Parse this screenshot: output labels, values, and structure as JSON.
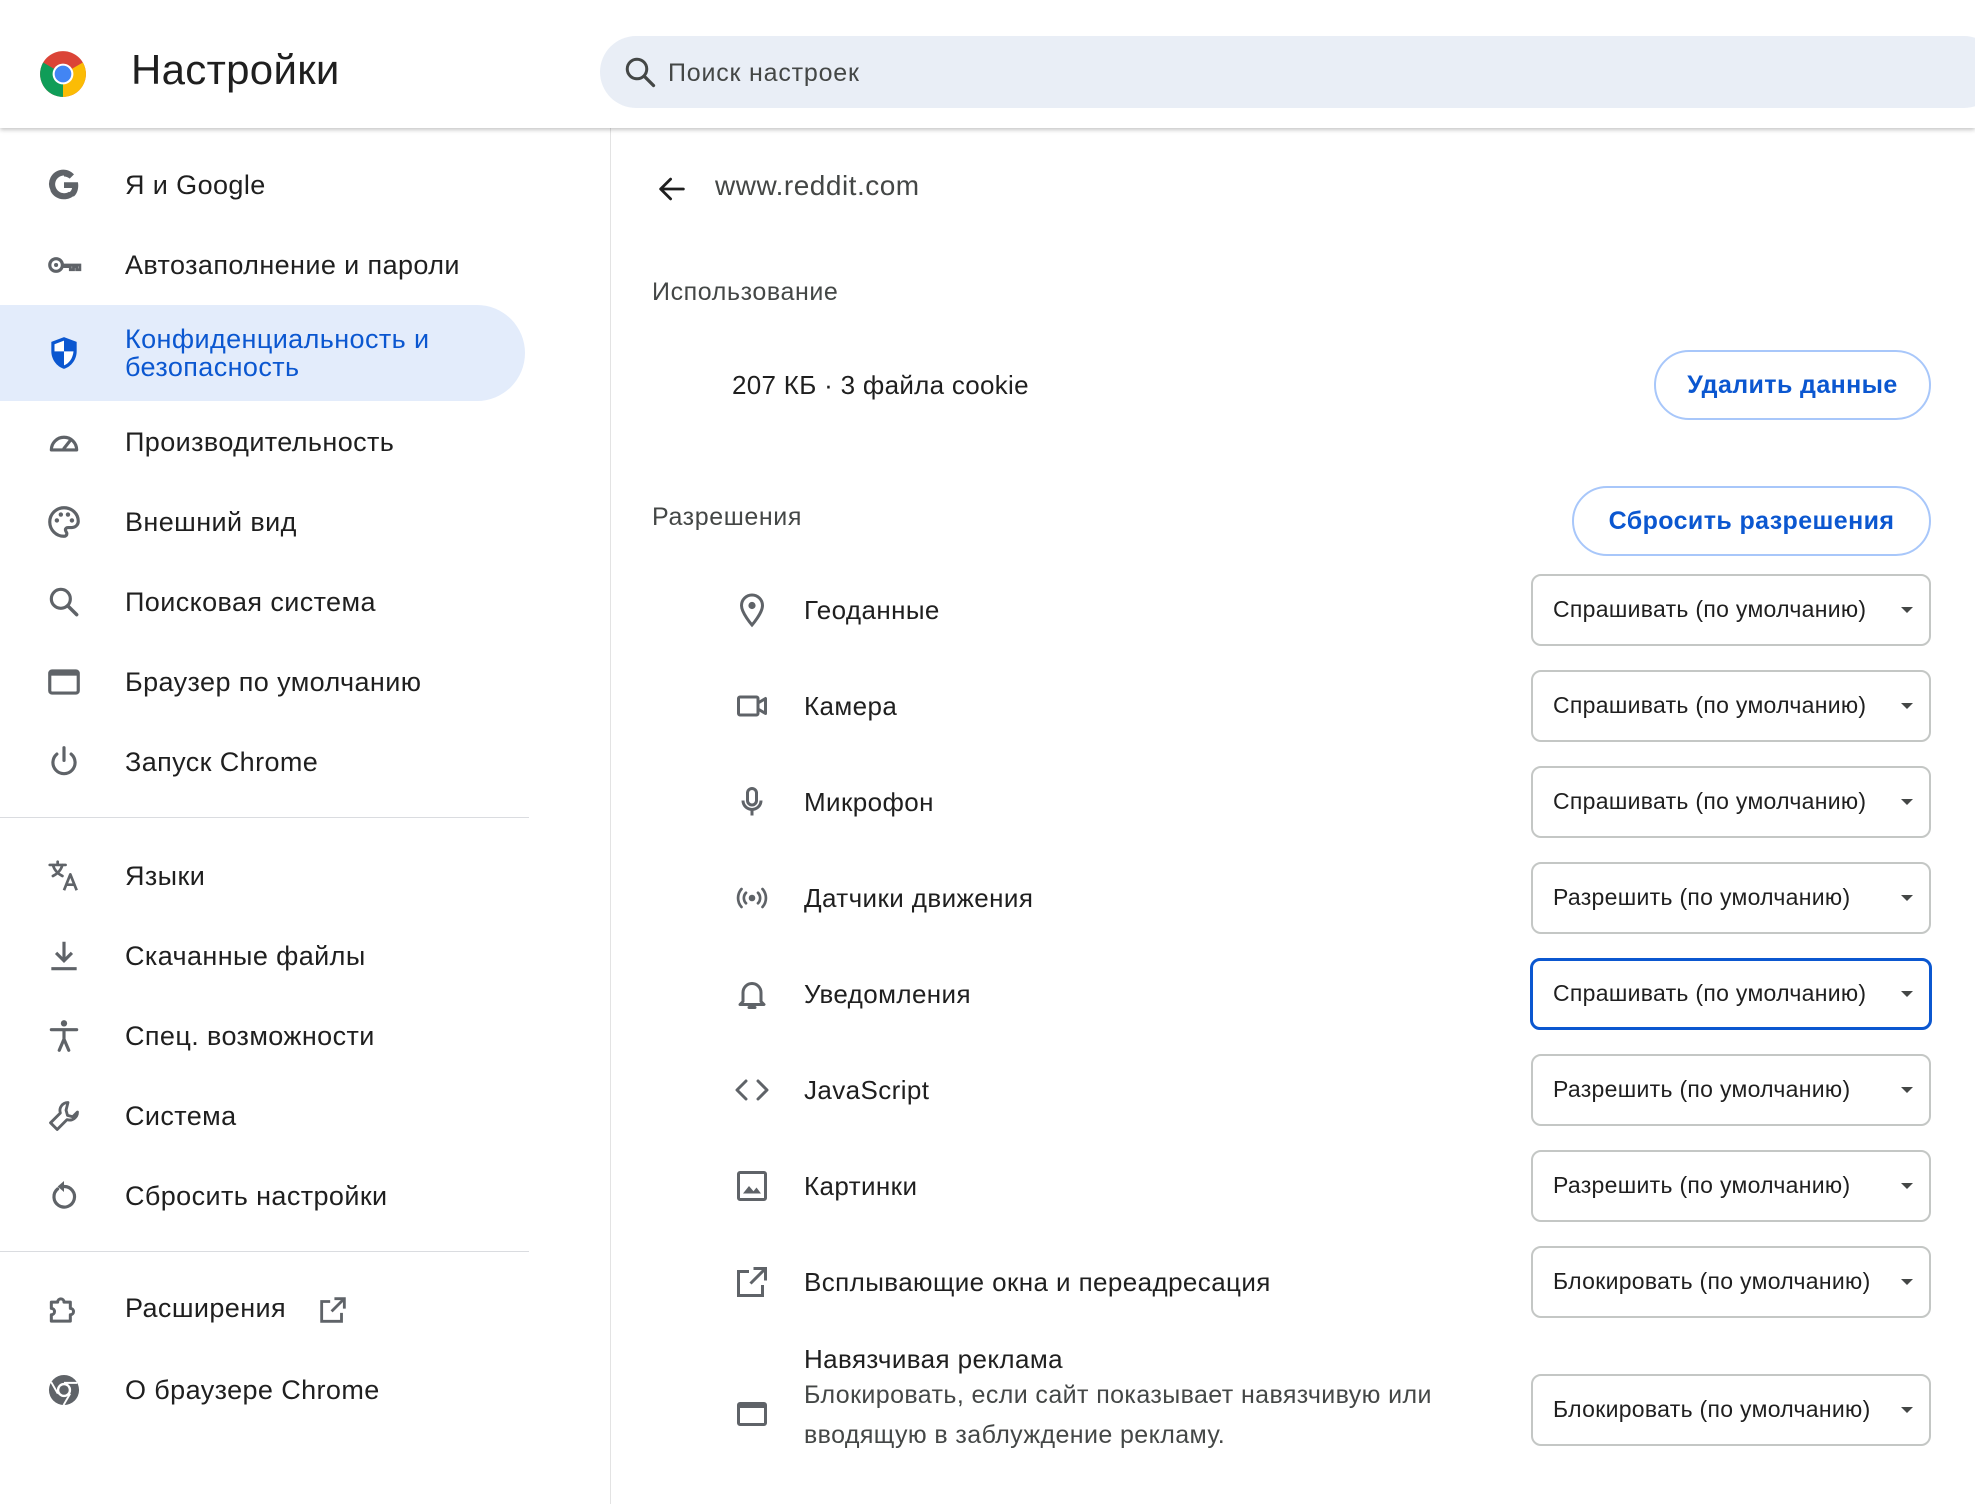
{
  "header": {
    "app_title": "Настройки",
    "search_placeholder": "Поиск настроек"
  },
  "sidebar": {
    "items": [
      {
        "label": "Я и Google",
        "icon": "google-g-icon"
      },
      {
        "label": "Автозаполнение и пароли",
        "icon": "key-icon"
      },
      {
        "label": "Конфиденциальность и безопасность",
        "icon": "shield-icon",
        "active": true
      },
      {
        "label": "Производительность",
        "icon": "speedometer-icon"
      },
      {
        "label": "Внешний вид",
        "icon": "palette-icon"
      },
      {
        "label": "Поисковая система",
        "icon": "search-icon"
      },
      {
        "label": "Браузер по умолчанию",
        "icon": "browser-window-icon"
      },
      {
        "label": "Запуск Chrome",
        "icon": "power-icon"
      },
      {
        "label": "Языки",
        "icon": "translate-icon"
      },
      {
        "label": "Скачанные файлы",
        "icon": "download-icon"
      },
      {
        "label": "Спец. возможности",
        "icon": "accessibility-icon"
      },
      {
        "label": "Система",
        "icon": "wrench-icon"
      },
      {
        "label": "Сбросить настройки",
        "icon": "reset-icon"
      },
      {
        "label": "Расширения",
        "icon": "puzzle-icon"
      },
      {
        "label": "О браузере Chrome",
        "icon": "chrome-icon"
      }
    ]
  },
  "main": {
    "site": "www.reddit.com",
    "usage": {
      "title": "Использование",
      "summary": "207 КБ · 3 файла cookie",
      "delete_button": "Удалить данные"
    },
    "permissions": {
      "title": "Разрешения",
      "reset_button": "Сбросить разрешения",
      "items": [
        {
          "label": "Геоданные",
          "value": "Спрашивать (по умолчанию)",
          "icon": "location-pin-icon"
        },
        {
          "label": "Камера",
          "value": "Спрашивать (по умолчанию)",
          "icon": "camera-icon"
        },
        {
          "label": "Микрофон",
          "value": "Спрашивать (по умолчанию)",
          "icon": "microphone-icon"
        },
        {
          "label": "Датчики движения",
          "value": "Разрешить (по умолчанию)",
          "icon": "sensors-icon"
        },
        {
          "label": "Уведомления",
          "value": "Спрашивать (по умолчанию)",
          "icon": "bell-icon",
          "focused": true
        },
        {
          "label": "JavaScript",
          "value": "Разрешить (по умолчанию)",
          "icon": "code-icon"
        },
        {
          "label": "Картинки",
          "value": "Разрешить (по умолчанию)",
          "icon": "image-icon"
        },
        {
          "label": "Всплывающие окна и переадресация",
          "value": "Блокировать (по умолчанию)",
          "icon": "open-external-icon"
        },
        {
          "label": "Навязчивая реклама",
          "description": "Блокировать, если сайт показывает навязчивую или вводящую в заблуждение рекламу.",
          "value": "Блокировать (по умолчанию)",
          "icon": "ad-window-icon"
        }
      ]
    }
  },
  "colors": {
    "accent": "#0b57d0",
    "active_nav_bg": "#e3ecfb",
    "search_bg": "#e9eef6"
  }
}
